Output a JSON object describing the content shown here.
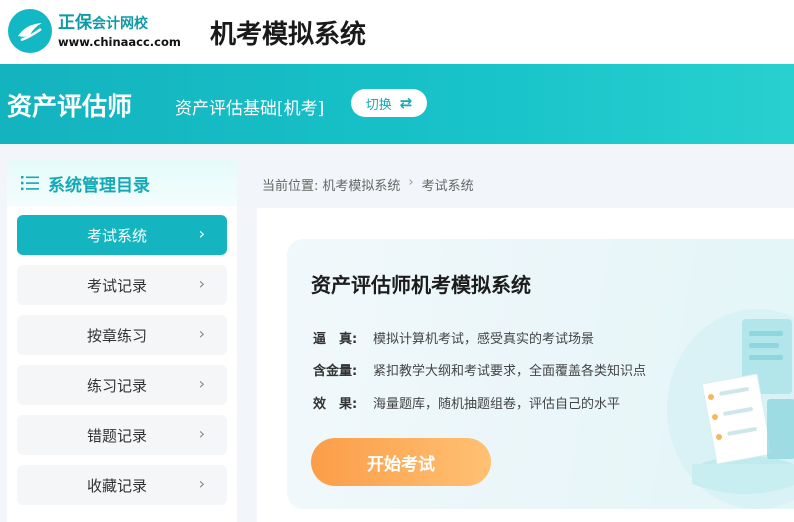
{
  "header": {
    "logo_main": "正保",
    "logo_sub": "会计网校",
    "logo_url": "www.chinaacc.com",
    "title": "机考模拟系统"
  },
  "banner": {
    "title": "资产评估师",
    "subject": "资产评估基础[机考]",
    "switch_label": "切换",
    "switch_icon": "swap-arrows-icon"
  },
  "sidebar": {
    "title": "系统管理目录",
    "title_icon": "list-icon",
    "items": [
      {
        "label": "考试系统",
        "active": true
      },
      {
        "label": "考试记录",
        "active": false
      },
      {
        "label": "按章练习",
        "active": false
      },
      {
        "label": "练习记录",
        "active": false
      },
      {
        "label": "错题记录",
        "active": false
      },
      {
        "label": "收藏记录",
        "active": false
      }
    ]
  },
  "breadcrumb": {
    "prefix": "当前位置:",
    "items": [
      "机考模拟系统",
      "考试系统"
    ]
  },
  "card": {
    "title": "资产评估师机考模拟系统",
    "features": [
      {
        "key": "逼　真:",
        "value": "模拟计算机考试，感受真实的考试场景"
      },
      {
        "key": "含金量:",
        "value": "紧扣教学大纲和考试要求，全面覆盖各类知识点"
      },
      {
        "key": "效　果:",
        "value": "海量题库，随机抽题组卷，评估自己的水平"
      }
    ],
    "start_button": "开始考试"
  },
  "colors": {
    "accent": "#14b5c0",
    "button_orange": "#fb9d48"
  }
}
